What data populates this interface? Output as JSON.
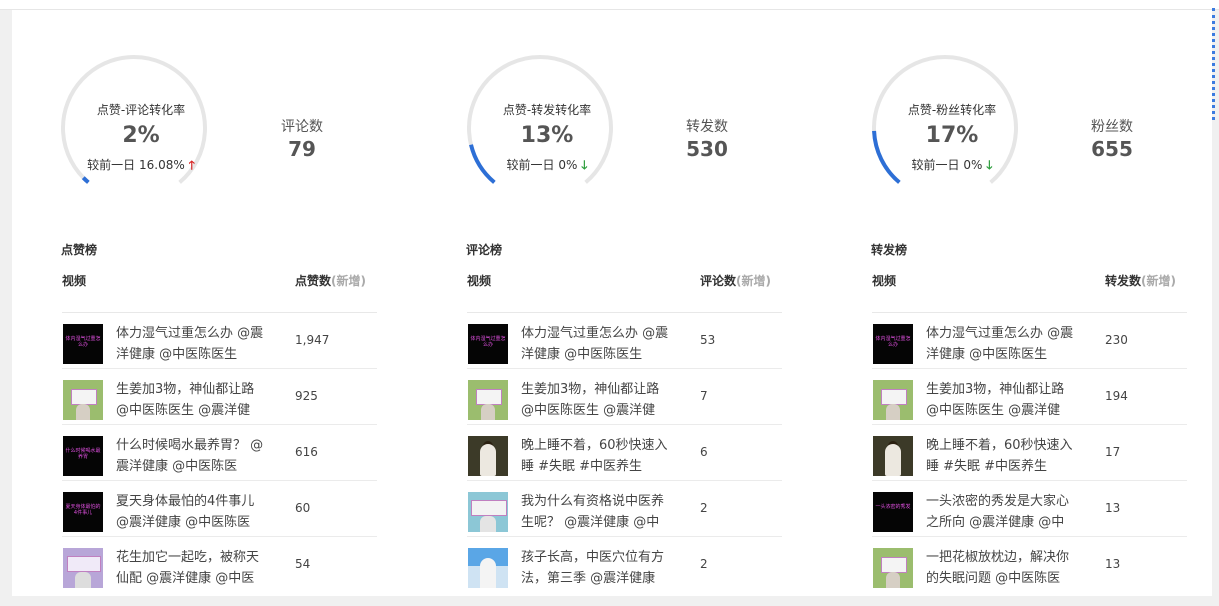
{
  "colors": {
    "gauge_arc": "#2d6fd6",
    "gauge_track": "#e6e6e6",
    "up": "#d62828",
    "down": "#2e9e3e"
  },
  "gauges": [
    {
      "title": "点赞-评论转化率",
      "value": "2%",
      "progress": 0.02,
      "compare_label": "较前一日",
      "compare_value": "16.08%",
      "trend": "up",
      "stat_label": "评论数",
      "stat_value": "79"
    },
    {
      "title": "点赞-转发转化率",
      "value": "13%",
      "progress": 0.13,
      "compare_label": "较前一日",
      "compare_value": "0%",
      "trend": "down",
      "stat_label": "转发数",
      "stat_value": "530"
    },
    {
      "title": "点赞-粉丝转化率",
      "value": "17%",
      "progress": 0.17,
      "compare_label": "较前一日",
      "compare_value": "0%",
      "trend": "down",
      "stat_label": "粉丝数",
      "stat_value": "655"
    }
  ],
  "rankings": [
    {
      "title": "点赞榜",
      "col_video": "视频",
      "col_metric": "点赞数",
      "col_new": "(新增)",
      "rows": [
        {
          "title": "体力湿气过重怎么办 @震洋健康 @中医陈医生",
          "value": "1,947",
          "thumb": "dark",
          "thumb_text": "体内湿气过重怎么办"
        },
        {
          "title": "生姜加3物，神仙都让路 @中医陈医生 @震洋健",
          "value": "925",
          "thumb": "green"
        },
        {
          "title": "什么时候喝水最养胃？ @震洋健康 @中医陈医",
          "value": "616",
          "thumb": "dark",
          "thumb_text": "什么时候喝水最养胃"
        },
        {
          "title": "夏天身体最怕的4件事儿 @震洋健康 @中医陈医",
          "value": "60",
          "thumb": "dark",
          "thumb_text": "夏天身体最怕的4件事儿"
        },
        {
          "title": "花生加它一起吃，被称天仙配 @震洋健康 @中医",
          "value": "54",
          "thumb": "purple"
        }
      ]
    },
    {
      "title": "评论榜",
      "col_video": "视频",
      "col_metric": "评论数",
      "col_new": "(新增)",
      "rows": [
        {
          "title": "体力湿气过重怎么办 @震洋健康 @中医陈医生",
          "value": "53",
          "thumb": "dark",
          "thumb_text": "体内湿气过重怎么办"
        },
        {
          "title": "生姜加3物，神仙都让路 @中医陈医生 @震洋健",
          "value": "7",
          "thumb": "green"
        },
        {
          "title": "晚上睡不着，60秒快速入睡 #失眠 #中医养生",
          "value": "6",
          "thumb": "brown"
        },
        {
          "title": "我为什么有资格说中医养生呢？ @震洋健康 @中",
          "value": "2",
          "thumb": "teal"
        },
        {
          "title": "孩子长高，中医穴位有方法，第三季 @震洋健康",
          "value": "2",
          "thumb": "blue"
        }
      ]
    },
    {
      "title": "转发榜",
      "col_video": "视频",
      "col_metric": "转发数",
      "col_new": "(新增)",
      "rows": [
        {
          "title": "体力湿气过重怎么办 @震洋健康 @中医陈医生",
          "value": "230",
          "thumb": "dark",
          "thumb_text": "体内湿气过重怎么办"
        },
        {
          "title": "生姜加3物，神仙都让路 @中医陈医生 @震洋健",
          "value": "194",
          "thumb": "green"
        },
        {
          "title": "晚上睡不着，60秒快速入睡 #失眠 #中医养生",
          "value": "17",
          "thumb": "brown"
        },
        {
          "title": "一头浓密的秀发是大家心之所向 @震洋健康 @中",
          "value": "13",
          "thumb": "dark",
          "thumb_text": "一头浓密的秀发"
        },
        {
          "title": "一把花椒放枕边，解决你的失眠问题 @中医陈医",
          "value": "13",
          "thumb": "green"
        }
      ]
    }
  ]
}
